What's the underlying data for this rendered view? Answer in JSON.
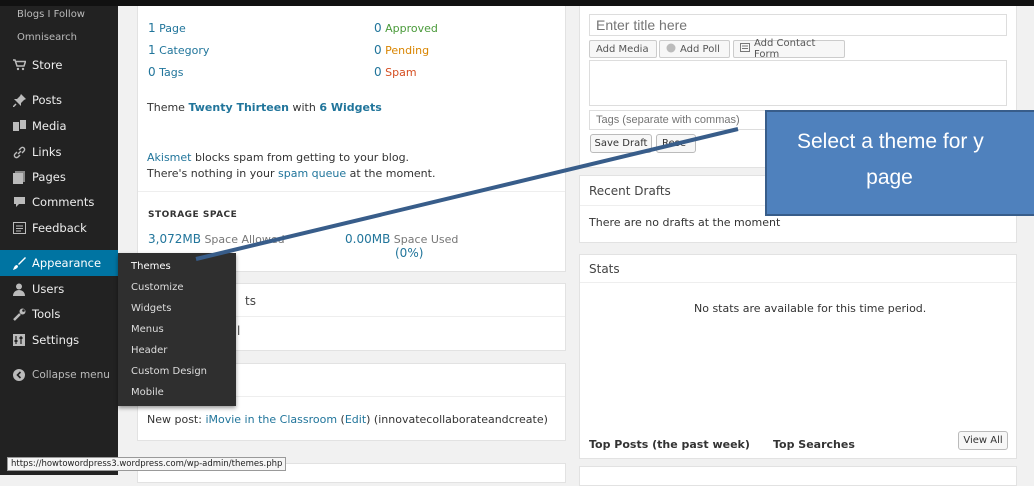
{
  "sidebar": {
    "items": [
      {
        "label": "Blogs I Follow"
      },
      {
        "label": "Omnisearch"
      },
      {
        "label": "Store",
        "icon": "cart-icon"
      },
      {
        "label": "Posts",
        "icon": "pin-icon"
      },
      {
        "label": "Media",
        "icon": "media-icon"
      },
      {
        "label": "Links",
        "icon": "link-icon"
      },
      {
        "label": "Pages",
        "icon": "pages-icon"
      },
      {
        "label": "Comments",
        "icon": "comment-icon"
      },
      {
        "label": "Feedback",
        "icon": "feedback-icon"
      },
      {
        "label": "Appearance",
        "icon": "brush-icon"
      },
      {
        "label": "Users",
        "icon": "user-icon"
      },
      {
        "label": "Tools",
        "icon": "wrench-icon"
      },
      {
        "label": "Settings",
        "icon": "settings-icon"
      },
      {
        "label": "Collapse menu",
        "icon": "collapse-icon"
      }
    ],
    "appearance_submenu": [
      "Themes",
      "Customize",
      "Widgets",
      "Menus",
      "Header",
      "Custom Design",
      "Mobile"
    ]
  },
  "right_now": {
    "pages": {
      "num": "1",
      "label": "Page"
    },
    "categories": {
      "num": "1",
      "label": "Category"
    },
    "tags": {
      "num": "0",
      "label": "Tags"
    },
    "approved": {
      "num": "0",
      "label": "Approved"
    },
    "pending": {
      "num": "0",
      "label": "Pending"
    },
    "spam": {
      "num": "0",
      "label": "Spam"
    },
    "theme_prefix": "Theme ",
    "theme_name": "Twenty Thirteen",
    "theme_with": " with ",
    "theme_widgets": "6 Widgets",
    "akismet_link": "Akismet",
    "akismet_text": " blocks spam from getting to your blog.",
    "spam_queue_prefix": "There's nothing in your ",
    "spam_queue_link": "spam queue",
    "spam_queue_suffix": " at the moment.",
    "storage_title": "STORAGE SPACE",
    "storage_allowed_value": "3,072MB",
    "storage_allowed_label": " Space Allowed",
    "storage_used_value": "0.00MB",
    "storage_used_label": " Space Used",
    "storage_used_pct": "(0%)"
  },
  "partial": {
    "ts": "ts",
    "l": "l"
  },
  "activity": {
    "prefix": "New post: ",
    "post_link": "iMovie in the Classroom",
    "edit_open": " (",
    "edit_link": "Edit",
    "edit_close": ")",
    "suffix": " (innovatecollaborateandcreate)"
  },
  "quick_draft": {
    "title_placeholder": "Enter title here",
    "add_media": "Add Media",
    "add_poll": "Add Poll",
    "add_contact_form": "Add Contact Form",
    "tags_placeholder": "Tags (separate with commas)",
    "save_draft": "Save Draft",
    "reset_partial": "Rese"
  },
  "recent_drafts": {
    "title": "Recent Drafts",
    "empty": "There are no drafts at the moment"
  },
  "stats": {
    "title": "Stats",
    "empty": "No stats are available for this time period.",
    "top_posts": "Top Posts (the past week)",
    "top_searches": "Top Searches",
    "view_all": "View All"
  },
  "callout": {
    "line1": "Select a theme for y",
    "line2": "page"
  },
  "status_url": "https://howtowordpress3.wordpress.com/wp-admin/themes.php",
  "colors": {
    "sidebar_bg": "#222222",
    "active_bg": "#0074a2",
    "link": "#21759b",
    "pending": "#d98500",
    "spam": "#d54e21",
    "callout_bg": "#4f81bd"
  }
}
